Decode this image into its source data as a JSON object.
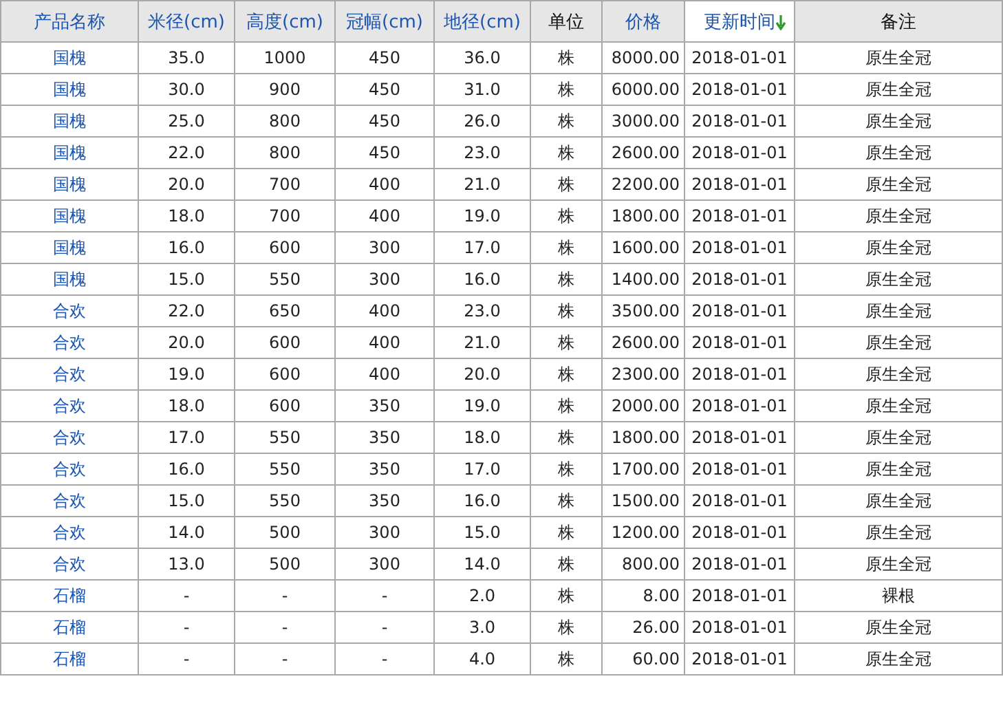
{
  "table": {
    "columns": [
      {
        "label": "产品名称",
        "kind": "link",
        "sorted": false
      },
      {
        "label": "米径(cm)",
        "kind": "link",
        "sorted": false
      },
      {
        "label": "高度(cm)",
        "kind": "link",
        "sorted": false
      },
      {
        "label": "冠幅(cm)",
        "kind": "link",
        "sorted": false
      },
      {
        "label": "地径(cm)",
        "kind": "link",
        "sorted": false
      },
      {
        "label": "单位",
        "kind": "plain",
        "sorted": false
      },
      {
        "label": "价格",
        "kind": "link",
        "sorted": false
      },
      {
        "label": "更新时间",
        "kind": "link",
        "sorted": true
      },
      {
        "label": "备注",
        "kind": "plain",
        "sorted": false
      }
    ],
    "rows": [
      [
        "国槐",
        "35.0",
        "1000",
        "450",
        "36.0",
        "株",
        "8000.00",
        "2018-01-01",
        "原生全冠"
      ],
      [
        "国槐",
        "30.0",
        "900",
        "450",
        "31.0",
        "株",
        "6000.00",
        "2018-01-01",
        "原生全冠"
      ],
      [
        "国槐",
        "25.0",
        "800",
        "450",
        "26.0",
        "株",
        "3000.00",
        "2018-01-01",
        "原生全冠"
      ],
      [
        "国槐",
        "22.0",
        "800",
        "450",
        "23.0",
        "株",
        "2600.00",
        "2018-01-01",
        "原生全冠"
      ],
      [
        "国槐",
        "20.0",
        "700",
        "400",
        "21.0",
        "株",
        "2200.00",
        "2018-01-01",
        "原生全冠"
      ],
      [
        "国槐",
        "18.0",
        "700",
        "400",
        "19.0",
        "株",
        "1800.00",
        "2018-01-01",
        "原生全冠"
      ],
      [
        "国槐",
        "16.0",
        "600",
        "300",
        "17.0",
        "株",
        "1600.00",
        "2018-01-01",
        "原生全冠"
      ],
      [
        "国槐",
        "15.0",
        "550",
        "300",
        "16.0",
        "株",
        "1400.00",
        "2018-01-01",
        "原生全冠"
      ],
      [
        "合欢",
        "22.0",
        "650",
        "400",
        "23.0",
        "株",
        "3500.00",
        "2018-01-01",
        "原生全冠"
      ],
      [
        "合欢",
        "20.0",
        "600",
        "400",
        "21.0",
        "株",
        "2600.00",
        "2018-01-01",
        "原生全冠"
      ],
      [
        "合欢",
        "19.0",
        "600",
        "400",
        "20.0",
        "株",
        "2300.00",
        "2018-01-01",
        "原生全冠"
      ],
      [
        "合欢",
        "18.0",
        "600",
        "350",
        "19.0",
        "株",
        "2000.00",
        "2018-01-01",
        "原生全冠"
      ],
      [
        "合欢",
        "17.0",
        "550",
        "350",
        "18.0",
        "株",
        "1800.00",
        "2018-01-01",
        "原生全冠"
      ],
      [
        "合欢",
        "16.0",
        "550",
        "350",
        "17.0",
        "株",
        "1700.00",
        "2018-01-01",
        "原生全冠"
      ],
      [
        "合欢",
        "15.0",
        "550",
        "350",
        "16.0",
        "株",
        "1500.00",
        "2018-01-01",
        "原生全冠"
      ],
      [
        "合欢",
        "14.0",
        "500",
        "300",
        "15.0",
        "株",
        "1200.00",
        "2018-01-01",
        "原生全冠"
      ],
      [
        "合欢",
        "13.0",
        "500",
        "300",
        "14.0",
        "株",
        "800.00",
        "2018-01-01",
        "原生全冠"
      ],
      [
        "石榴",
        "-",
        "-",
        "-",
        "2.0",
        "株",
        "8.00",
        "2018-01-01",
        "裸根"
      ],
      [
        "石榴",
        "-",
        "-",
        "-",
        "3.0",
        "株",
        "26.00",
        "2018-01-01",
        "原生全冠"
      ],
      [
        "石榴",
        "-",
        "-",
        "-",
        "4.0",
        "株",
        "60.00",
        "2018-01-01",
        "原生全冠"
      ]
    ]
  }
}
